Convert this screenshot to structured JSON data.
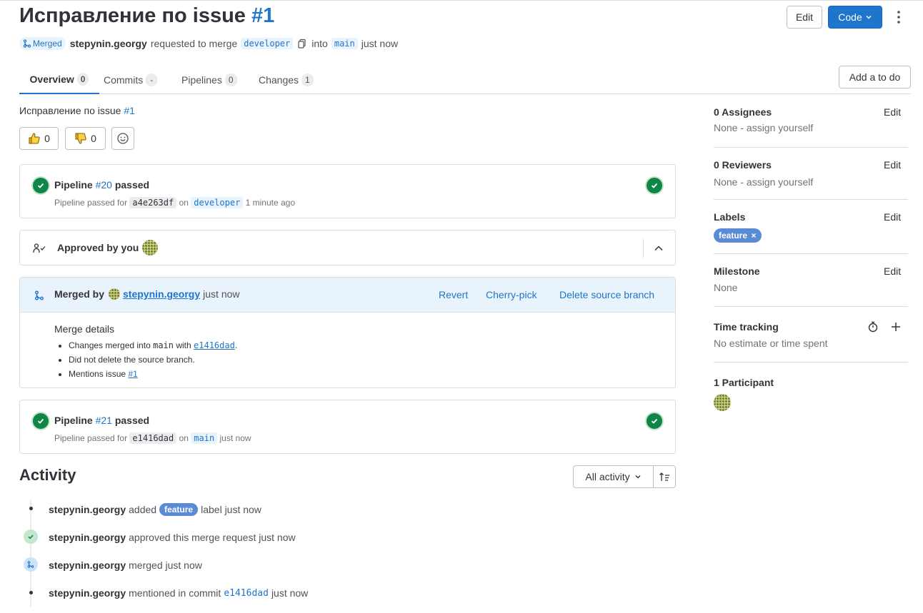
{
  "header": {
    "title_text": "Исправление по issue",
    "title_ref": "#1",
    "status_badge": "Merged",
    "author": "stepynin.georgy",
    "requested_text": "requested to merge",
    "source_branch": "developer",
    "into_text": "into",
    "target_branch": "main",
    "time": "just now",
    "edit_label": "Edit",
    "code_label": "Code"
  },
  "tabs": [
    {
      "label": "Overview",
      "count": "0"
    },
    {
      "label": "Commits",
      "count": "-"
    },
    {
      "label": "Pipelines",
      "count": "0"
    },
    {
      "label": "Changes",
      "count": "1"
    }
  ],
  "add_todo_label": "Add a to do",
  "description": {
    "text": "Исправление по issue",
    "ref": "#1"
  },
  "reactions": {
    "thumbs_up": "0",
    "thumbs_down": "0"
  },
  "pipeline1": {
    "prefix": "Pipeline",
    "ref": "#20",
    "status": "passed",
    "detail_prefix": "Pipeline passed for",
    "commit": "a4e263df",
    "on_text": "on",
    "branch": "developer",
    "time": "1 minute ago"
  },
  "approval": {
    "text": "Approved by you"
  },
  "merged": {
    "prefix": "Merged by",
    "user": "stepynin.georgy",
    "time": "just now",
    "revert": "Revert",
    "cherry_pick": "Cherry-pick",
    "delete_branch": "Delete source branch",
    "details_title": "Merge details",
    "item1_prefix": "Changes merged into",
    "item1_branch": "main",
    "item1_with": "with",
    "item1_commit": "e1416dad",
    "item1_end": ".",
    "item2": "Did not delete the source branch.",
    "item3_prefix": "Mentions issue",
    "item3_ref": "#1"
  },
  "pipeline2": {
    "prefix": "Pipeline",
    "ref": "#21",
    "status": "passed",
    "detail_prefix": "Pipeline passed for",
    "commit": "e1416dad",
    "on_text": "on",
    "branch": "main",
    "time": "just now"
  },
  "activity": {
    "title": "Activity",
    "filter_label": "All activity",
    "items": [
      {
        "user": "stepynin.georgy",
        "pre": "added",
        "label": "feature",
        "post": "label just now"
      },
      {
        "user": "stepynin.georgy",
        "text": "approved this merge request just now"
      },
      {
        "user": "stepynin.georgy",
        "text": "merged just now"
      },
      {
        "user": "stepynin.georgy",
        "pre": "mentioned in commit",
        "commit": "e1416dad",
        "post": "just now"
      }
    ]
  },
  "sidebar": {
    "assignees_title": "0 Assignees",
    "assignees_text": "None - assign yourself",
    "reviewers_title": "0 Reviewers",
    "reviewers_text": "None - assign yourself",
    "labels_title": "Labels",
    "label_name": "feature",
    "milestone_title": "Milestone",
    "milestone_text": "None",
    "time_title": "Time tracking",
    "time_text": "No estimate or time spent",
    "participants_title": "1 Participant",
    "edit_label": "Edit"
  },
  "colors": {
    "accent": "#1f75cb",
    "success": "#108548",
    "label_bg": "#5c8bd6"
  }
}
